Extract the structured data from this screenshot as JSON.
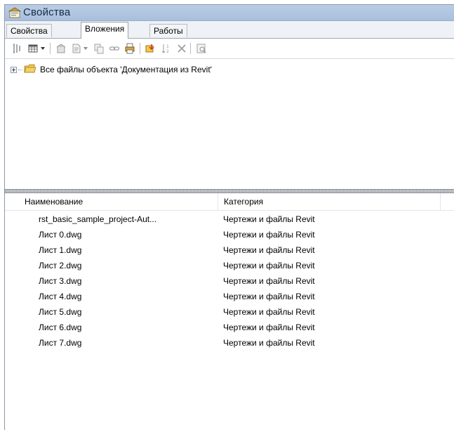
{
  "window": {
    "title": "Свойства"
  },
  "tabs": [
    {
      "label": "Свойства",
      "active": false
    },
    {
      "label": "Вложения",
      "active": true
    },
    {
      "label": "Работы",
      "active": false
    }
  ],
  "toolbar": {
    "icons": [
      "columns-icon",
      "grid-view-icon",
      "dropdown-arrow-icon",
      "properties-icon",
      "new-document-icon",
      "copy-icon",
      "link-icon",
      "print-icon",
      "import-icon",
      "sort-icon",
      "delete-icon",
      "preview-icon"
    ]
  },
  "tree": {
    "root_label": "Все файлы объекта 'Документация из Revit'",
    "expanded": false
  },
  "list": {
    "columns": [
      "Наименование",
      "Категория",
      ""
    ],
    "rows": [
      {
        "name": "rst_basic_sample_project-Aut...",
        "category": "Чертежи и файлы Revit"
      },
      {
        "name": "Лист 0.dwg",
        "category": "Чертежи и файлы Revit"
      },
      {
        "name": "Лист 1.dwg",
        "category": "Чертежи и файлы Revit"
      },
      {
        "name": "Лист 2.dwg",
        "category": "Чертежи и файлы Revit"
      },
      {
        "name": "Лист 3.dwg",
        "category": "Чертежи и файлы Revit"
      },
      {
        "name": "Лист 4.dwg",
        "category": "Чертежи и файлы Revit"
      },
      {
        "name": "Лист 5.dwg",
        "category": "Чертежи и файлы Revit"
      },
      {
        "name": "Лист 6.dwg",
        "category": "Чертежи и файлы Revit"
      },
      {
        "name": "Лист 7.dwg",
        "category": "Чертежи и файлы Revit"
      }
    ]
  },
  "colors": {
    "titlebar": "#b9cde5",
    "folder": "#f2c84b",
    "accent_red": "#d23a2a"
  }
}
